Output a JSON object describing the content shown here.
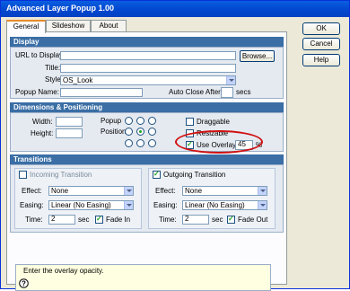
{
  "window": {
    "title": "Advanced Layer Popup 1.00"
  },
  "tabs": [
    "General",
    "Slideshow",
    "About"
  ],
  "side_buttons": {
    "ok": "OK",
    "cancel": "Cancel",
    "help": "Help"
  },
  "display": {
    "header": "Display",
    "url_label": "URL to Display:",
    "url_value": "",
    "browse": "Browse...",
    "title_label": "Title:",
    "title_value": "",
    "style_label": "Style:",
    "style_value": "OS_Look",
    "popup_name_label": "Popup Name:",
    "popup_name_value": "",
    "auto_close_label": "Auto Close After",
    "auto_close_value": "",
    "secs": "secs"
  },
  "dims": {
    "header": "Dimensions & Positioning",
    "width_label": "Width:",
    "height_label": "Height:",
    "popup_label": "Popup",
    "position_label": "Position",
    "draggable": "Draggable",
    "resizable": "Resizable",
    "use_overlay": "Use Overlay",
    "overlay_value": "45",
    "percent": "%"
  },
  "transitions": {
    "header": "Transitions",
    "incoming": {
      "title": "Incoming Transition",
      "effect_label": "Effect:",
      "effect_value": "None",
      "easing_label": "Easing:",
      "easing_value": "Linear (No Easing)",
      "time_label": "Time:",
      "time_value": "2",
      "sec": "sec",
      "fade_label": "Fade In"
    },
    "outgoing": {
      "title": "Outgoing Transition",
      "effect_label": "Effect:",
      "effect_value": "None",
      "easing_label": "Easing:",
      "easing_value": "Linear (No Easing)",
      "time_label": "Time:",
      "time_value": "2",
      "sec": "sec",
      "fade_label": "Fade Out"
    }
  },
  "hint": {
    "text": "Enter the overlay opacity.",
    "icon": "question-icon"
  },
  "colors": {
    "highlight_oval": "#d01010",
    "section_header": "#3a6ea5"
  }
}
